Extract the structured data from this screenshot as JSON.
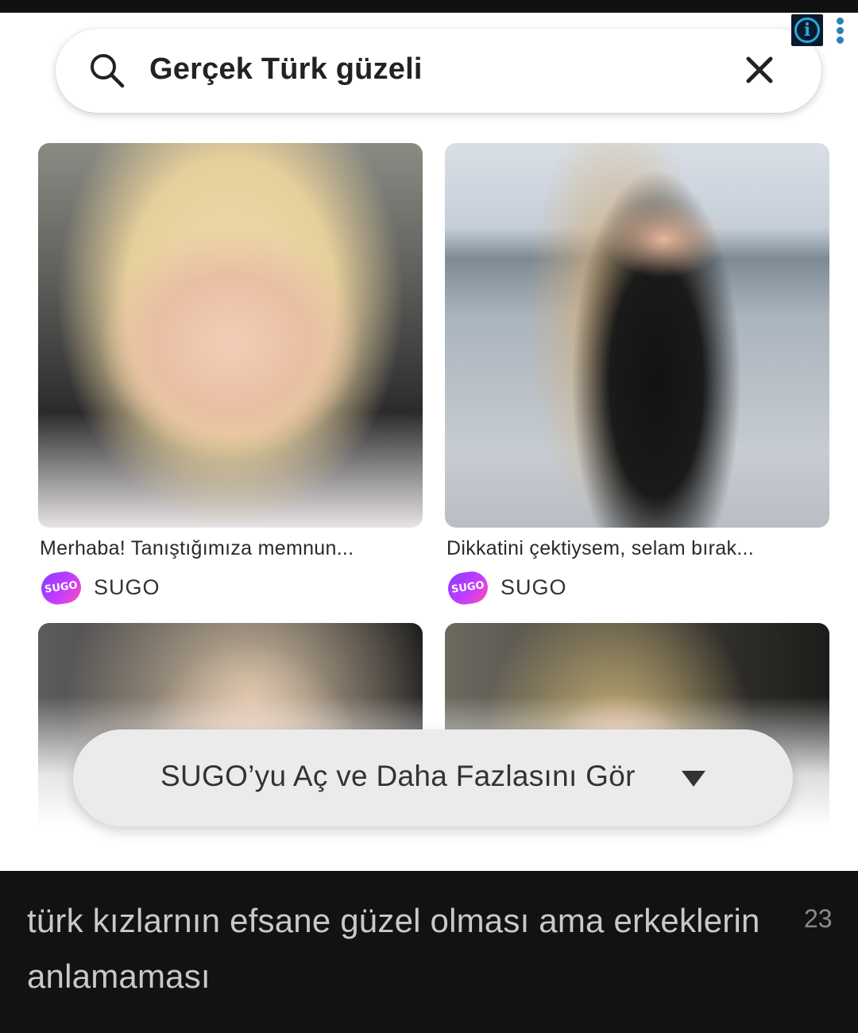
{
  "search": {
    "query": "Gerçek Türk güzeli"
  },
  "ad_choices": {
    "info_glyph": "i"
  },
  "cards": [
    {
      "caption": "Merhaba! Tanıştığımıza memnun...",
      "brand_logo_text": "SUGO",
      "brand_name": "SUGO"
    },
    {
      "caption": "Dikkatini çektiysem, selam bırak...",
      "brand_logo_text": "SUGO",
      "brand_name": "SUGO"
    }
  ],
  "cta": {
    "label": "SUGO’yu Aç ve Daha Fazlasını Gör"
  },
  "comment": {
    "text": "türk kızlarnın efsane güzel olması ama erkeklerin anlamaması",
    "count": "23"
  },
  "colors": {
    "accent_brand": "#b13cff",
    "ad_info_blue": "#29a8e0",
    "comment_bg": "#121212"
  }
}
